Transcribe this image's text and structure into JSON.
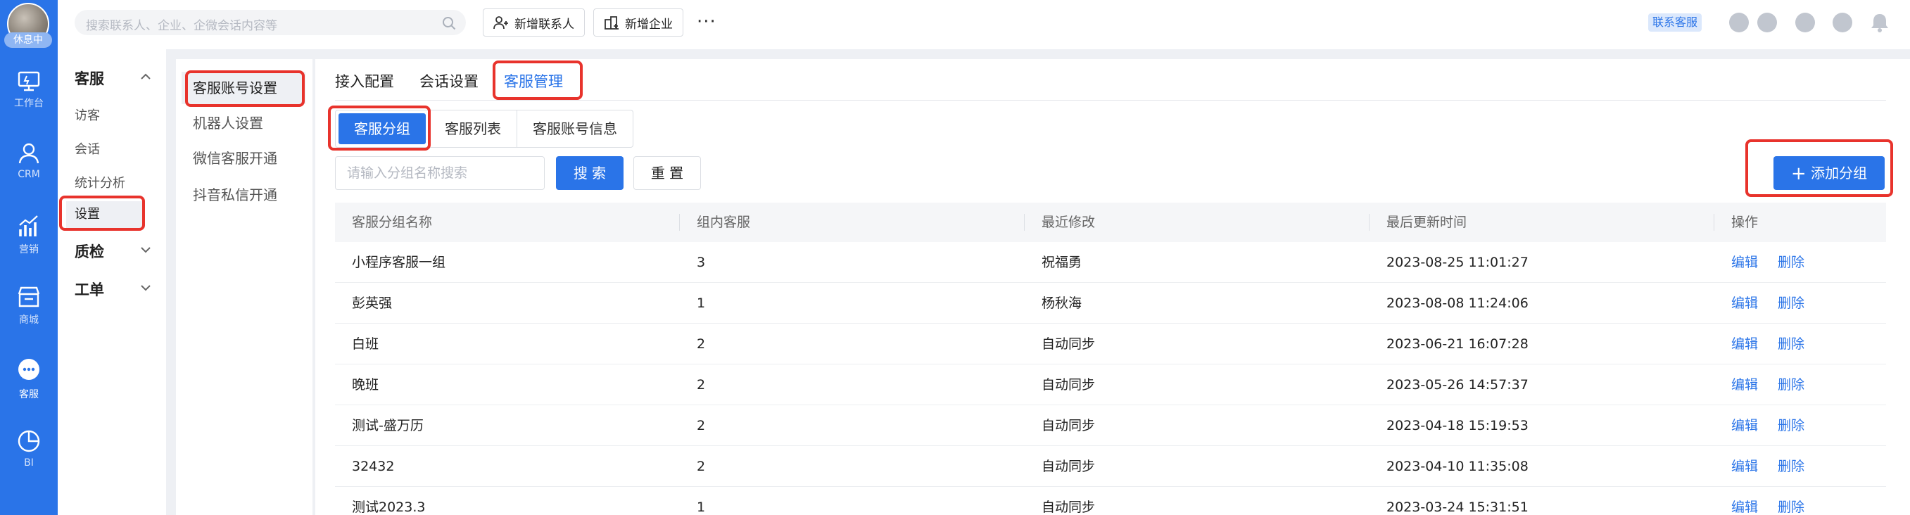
{
  "rail": {
    "status": "休息中",
    "items": [
      {
        "label": "工作台",
        "icon": "workbench-icon"
      },
      {
        "label": "CRM",
        "icon": "person-icon"
      },
      {
        "label": "营销",
        "icon": "chart-icon"
      },
      {
        "label": "商城",
        "icon": "store-icon"
      },
      {
        "label": "客服",
        "icon": "chat-icon"
      },
      {
        "label": "BI",
        "icon": "pie-icon"
      }
    ]
  },
  "topbar": {
    "search_placeholder": "搜索联系人、企业、企微会话内容等",
    "add_contact": "新增联系人",
    "add_company": "新增企业",
    "more": "···",
    "contact_support": "联系客服"
  },
  "nav2": {
    "group_service": "客服",
    "items": [
      "访客",
      "会话",
      "统计分析",
      "设置"
    ],
    "group_qc": "质检",
    "group_ticket": "工单"
  },
  "nav3": {
    "items": [
      "客服账号设置",
      "机器人设置",
      "微信客服开通",
      "抖音私信开通"
    ]
  },
  "main": {
    "tabs": [
      "接入配置",
      "会话设置",
      "客服管理"
    ],
    "segments": [
      "客服分组",
      "客服列表",
      "客服账号信息"
    ],
    "filter_placeholder": "请输入分组名称搜索",
    "search_btn": "搜 索",
    "reset_btn": "重 置",
    "add_group_btn": "添加分组",
    "columns": [
      "客服分组名称",
      "组内客服",
      "最近修改",
      "最后更新时间",
      "操作"
    ],
    "edit": "编辑",
    "delete": "删除",
    "rows": [
      [
        "小程序客服一组",
        "3",
        "祝福勇",
        "2023-08-25 11:01:27"
      ],
      [
        "彭英强",
        "1",
        "杨秋海",
        "2023-08-08 11:24:06"
      ],
      [
        "白班",
        "2",
        "自动同步",
        "2023-06-21 16:07:28"
      ],
      [
        "晚班",
        "2",
        "自动同步",
        "2023-05-26 14:57:37"
      ],
      [
        "测试-盛万历",
        "2",
        "自动同步",
        "2023-04-18 15:19:53"
      ],
      [
        "32432",
        "2",
        "自动同步",
        "2023-04-10 11:35:08"
      ],
      [
        "测试2023.3",
        "1",
        "自动同步",
        "2023-03-24 15:31:51"
      ]
    ]
  },
  "colors": {
    "accent": "#2a74e8",
    "highlight": "#e8332c"
  }
}
